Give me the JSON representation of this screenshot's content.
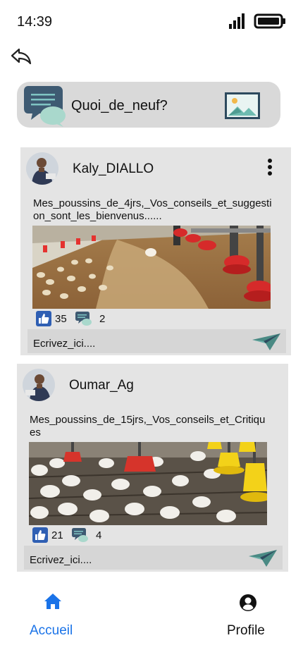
{
  "status_bar": {
    "time": "14:39"
  },
  "composer": {
    "placeholder": "Quoi_de_neuf?",
    "chat_icon": "chat-bubbles-icon",
    "image_icon": "image-icon"
  },
  "posts": [
    {
      "author": "Kaly_DIALLO",
      "text": "Mes_poussins_de_4jrs,_Vos_conseils_et_suggestion_sont_les_bienvenus......",
      "likes": "35",
      "comments": "2",
      "comment_placeholder": "Ecrivez_ici...."
    },
    {
      "author": "Oumar_Ag",
      "text": "Mes_poussins_de_15jrs,_Vos_conseils_et_Critiques",
      "likes": "21",
      "comments": "4",
      "comment_placeholder": "Ecrivez_ici...."
    }
  ],
  "nav": {
    "home_label": "Accueil",
    "profile_label": "Profile"
  },
  "colors": {
    "accent": "#1a73e8",
    "card_bg": "#e4e4e4",
    "composer_bg": "#d9d9d9",
    "like_blue": "#2f5fb3",
    "send_teal": "#4a8a84"
  }
}
